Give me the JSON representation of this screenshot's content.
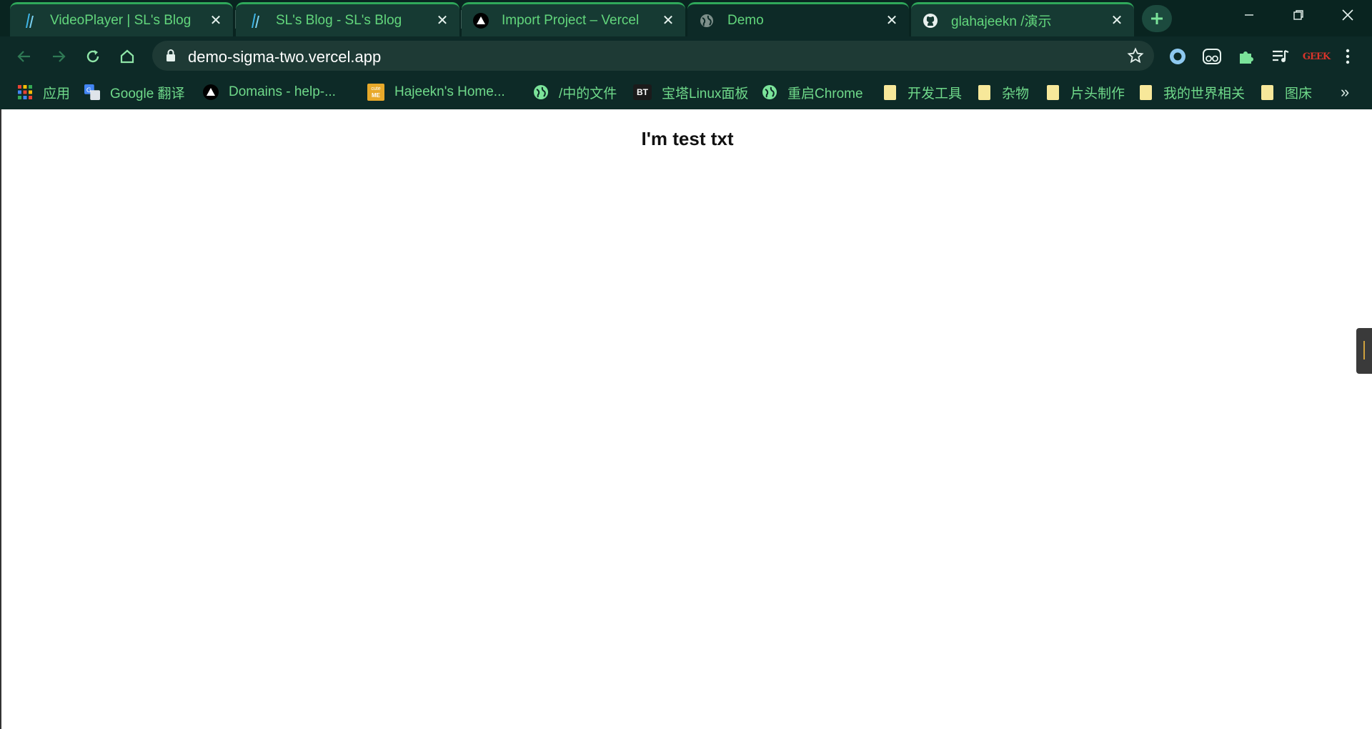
{
  "tabs": [
    {
      "title": "VideoPlayer | SL's Blog",
      "icon": "sl-blog-icon"
    },
    {
      "title": "SL's Blog - SL's Blog",
      "icon": "sl-blog-icon"
    },
    {
      "title": "Import Project – Vercel",
      "icon": "vercel-icon"
    },
    {
      "title": "Demo",
      "icon": "globe-icon",
      "active": true
    },
    {
      "title": "glahajeekn /演示",
      "icon": "github-icon"
    }
  ],
  "toolbar": {
    "url": "demo-sigma-two.vercel.app"
  },
  "bookmarks": [
    {
      "label": "应用",
      "icon": "apps-grid-icon"
    },
    {
      "label": "Google 翻译",
      "icon": "google-translate-icon"
    },
    {
      "label": "Domains - help-...",
      "icon": "vercel-icon"
    },
    {
      "label": "Hajeekn's Home...",
      "icon": "cute-me-icon"
    },
    {
      "label": "/中的文件",
      "icon": "globe-icon"
    },
    {
      "label": "宝塔Linux面板",
      "icon": "bt-icon"
    },
    {
      "label": "重启Chrome",
      "icon": "globe-icon"
    },
    {
      "label": "开发工具",
      "icon": "folder-icon"
    },
    {
      "label": "杂物",
      "icon": "folder-icon"
    },
    {
      "label": "片头制作",
      "icon": "folder-icon"
    },
    {
      "label": "我的世界相关",
      "icon": "folder-icon"
    },
    {
      "label": "图床",
      "icon": "folder-icon"
    }
  ],
  "bookmark_badges": {
    "bt": "BT",
    "cute": "cute",
    "me": "ME"
  },
  "extensions": {
    "geek_label": "GEEK"
  },
  "page": {
    "heading": "I'm test txt"
  },
  "colors": {
    "chrome_bg": "#0d2a27",
    "tab_text": "#62d67c",
    "accent": "#2fa85a"
  }
}
